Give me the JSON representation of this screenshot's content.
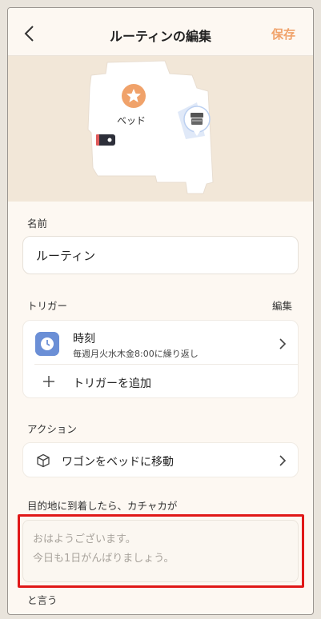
{
  "header": {
    "title": "ルーティンの編集",
    "save_label": "保存"
  },
  "map": {
    "room_label": "ベッド"
  },
  "name_section": {
    "label": "名前",
    "value": "ルーティン"
  },
  "trigger_section": {
    "label": "トリガー",
    "edit_label": "編集",
    "trigger": {
      "title": "時刻",
      "subtitle": "毎週月火水木金8:00に繰り返し"
    },
    "add_label": "トリガーを追加"
  },
  "action_section": {
    "label": "アクション",
    "action_label": "ワゴンをベッドに移動"
  },
  "speech_section": {
    "prefix_label": "目的地に到着したら、カチャカが",
    "placeholder_line1": "おはようございます。",
    "placeholder_line2": "今日も1日がんばりましょう。",
    "suffix_label": "と言う"
  },
  "colors": {
    "accent": "#f0a26a",
    "clock_badge": "#6b8fd6",
    "highlight": "#e01818",
    "map_bg": "#f2e7d8"
  }
}
